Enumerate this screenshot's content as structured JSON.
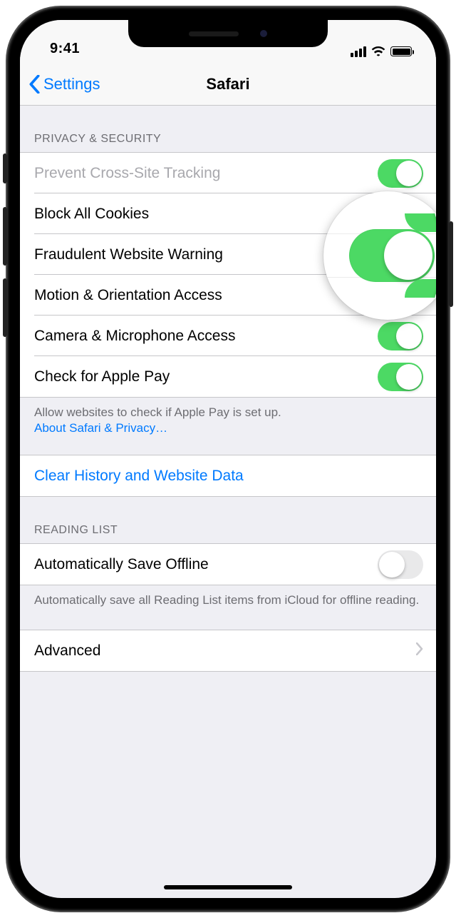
{
  "statusbar": {
    "time": "9:41"
  },
  "nav": {
    "back": "Settings",
    "title": "Safari"
  },
  "sections": {
    "privacy": {
      "header": "PRIVACY & SECURITY",
      "rows": [
        {
          "label": "Prevent Cross-Site Tracking",
          "on": true,
          "disabled": true
        },
        {
          "label": "Block All Cookies",
          "on": true,
          "magnified": true
        },
        {
          "label": "Fraudulent Website Warning",
          "on": true
        },
        {
          "label": "Motion & Orientation Access",
          "on": false
        },
        {
          "label": "Camera & Microphone Access",
          "on": true
        },
        {
          "label": "Check for Apple Pay",
          "on": true
        }
      ],
      "footer": "Allow websites to check if Apple Pay is set up.",
      "footer_link": "About Safari & Privacy…"
    },
    "action": {
      "label": "Clear History and Website Data"
    },
    "reading": {
      "header": "READING LIST",
      "rows": [
        {
          "label": "Automatically Save Offline",
          "on": false
        }
      ],
      "footer": "Automatically save all Reading List items from iCloud for offline reading."
    },
    "advanced": {
      "label": "Advanced"
    }
  }
}
